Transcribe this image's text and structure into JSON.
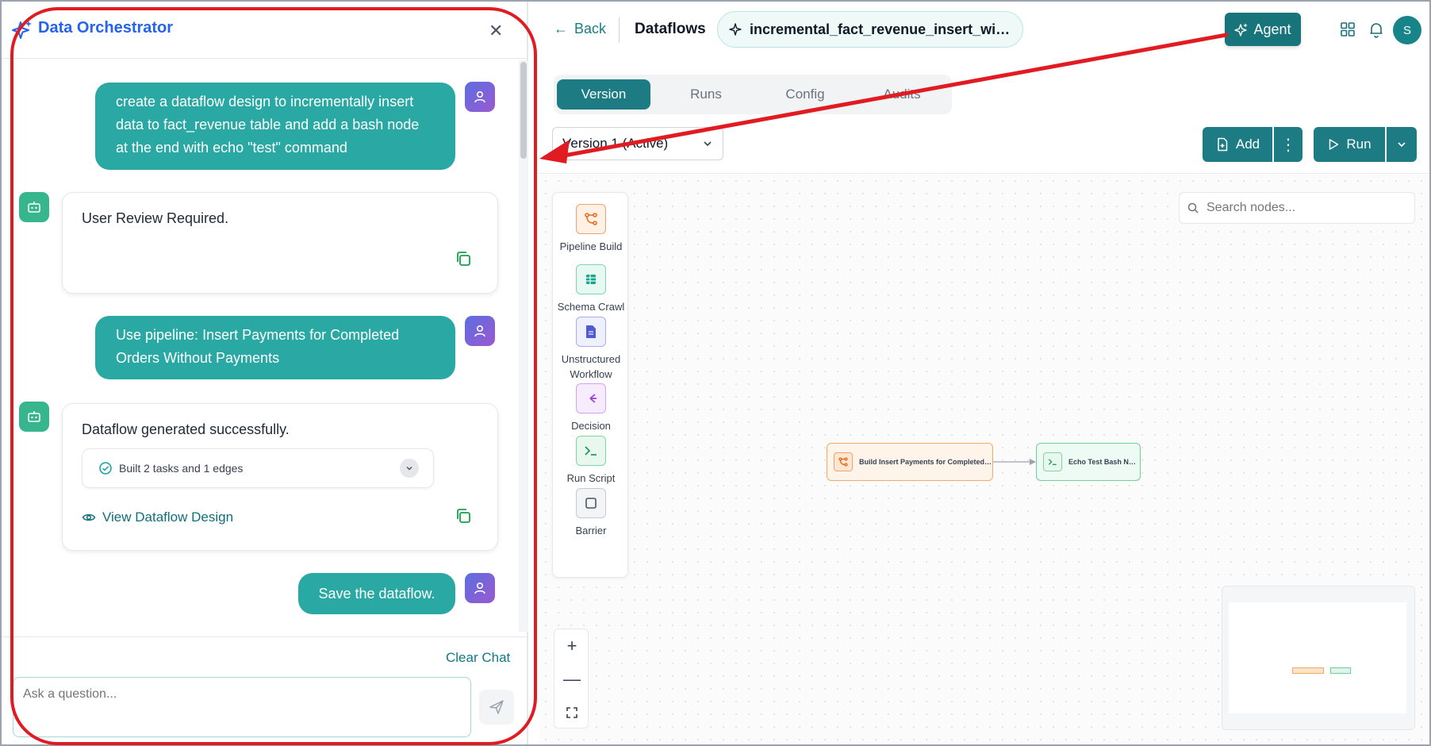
{
  "chat": {
    "title": "Data Orchestrator",
    "messages": [
      {
        "role": "user",
        "text": "create a dataflow design to incrementally insert data to fact_revenue table and add a bash node at the end with echo \"test\" command"
      },
      {
        "role": "bot",
        "text": "User Review Required."
      },
      {
        "role": "user",
        "text": "Use pipeline: Insert Payments for Completed Orders Without Payments"
      },
      {
        "role": "bot",
        "text": "Dataflow generated successfully.",
        "summary": "Built 2 tasks and 1 edges",
        "link": "View Dataflow Design"
      },
      {
        "role": "user",
        "text": "Save the dataflow."
      }
    ],
    "clear_label": "Clear Chat",
    "input_placeholder": "Ask a question..."
  },
  "topbar": {
    "back_label": "Back",
    "crumb": "Dataflows",
    "flow_name": "incremental_fact_revenue_insert_with_...",
    "agent_label": "Agent",
    "user_initial": "S"
  },
  "tabs": [
    "Version",
    "Runs",
    "Config",
    "Audits"
  ],
  "version_select": "Version 1 (Active)",
  "toolbar": {
    "add_label": "Add",
    "run_label": "Run"
  },
  "palette": [
    {
      "label": "Pipeline Build",
      "icon": "pipeline-icon",
      "color": "#ea6b1f"
    },
    {
      "label": "Schema Crawl",
      "icon": "table-icon",
      "color": "#17a58c"
    },
    {
      "label": "Unstructured Workflow",
      "icon": "document-icon",
      "color": "#4f5bd5"
    },
    {
      "label": "Decision",
      "icon": "decision-icon",
      "color": "#9b3fd6"
    },
    {
      "label": "Run Script",
      "icon": "terminal-icon",
      "color": "#1e9e58"
    },
    {
      "label": "Barrier",
      "icon": "square-icon",
      "color": "#4b5563"
    }
  ],
  "search_placeholder": "Search nodes...",
  "nodes": [
    {
      "label": "Build Insert Payments for Completed ...",
      "type": "pipeline"
    },
    {
      "label": "Echo Test Bash Node",
      "type": "script"
    }
  ],
  "colors": {
    "accent": "#1c7b83",
    "user_bubble": "#2aa8a4",
    "annotation": "#e11b22"
  }
}
